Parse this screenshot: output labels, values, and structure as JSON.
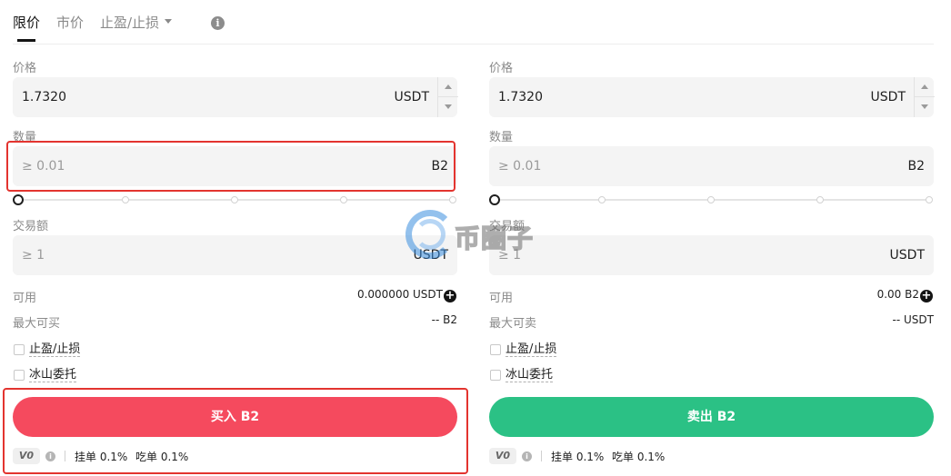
{
  "tabs": {
    "limit": "限价",
    "market": "市价",
    "tpsl": "止盈/止损"
  },
  "buy": {
    "price_label": "价格",
    "price_value": "1.7320",
    "price_unit": "USDT",
    "amount_label": "数量",
    "amount_placeholder": "≥ 0.01",
    "amount_unit": "B2",
    "total_label": "交易额",
    "total_placeholder": "≥ 1",
    "total_unit": "USDT",
    "available_label": "可用",
    "available_value": "0.000000 USDT",
    "max_label": "最大可买",
    "max_value": "-- B2",
    "opt_tpsl": "止盈/止损",
    "opt_iceberg": "冰山委托",
    "action_label": "买入 B2",
    "vip": "V0",
    "maker_fee": "挂单 0.1%",
    "taker_fee": "吃单 0.1%",
    "slider_percent": 0
  },
  "sell": {
    "price_label": "价格",
    "price_value": "1.7320",
    "price_unit": "USDT",
    "amount_label": "数量",
    "amount_placeholder": "≥ 0.01",
    "amount_unit": "B2",
    "total_label": "交易额",
    "total_placeholder": "≥ 1",
    "total_unit": "USDT",
    "available_label": "可用",
    "available_value": "0.00 B2",
    "max_label": "最大可卖",
    "max_value": "-- USDT",
    "opt_tpsl": "止盈/止损",
    "opt_iceberg": "冰山委托",
    "action_label": "卖出 B2",
    "vip": "V0",
    "maker_fee": "挂单 0.1%",
    "taker_fee": "吃单 0.1%",
    "slider_percent": 0
  },
  "watermark": "币圈子",
  "colors": {
    "buy": "#f54a5e",
    "sell": "#2bc185",
    "highlight": "#e3342f"
  }
}
